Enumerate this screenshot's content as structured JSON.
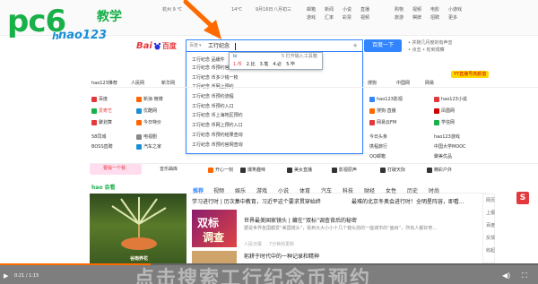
{
  "watermark": {
    "brand_pc": "pc6",
    "brand_cn": "教学",
    "brand_sub": "nao123",
    "brand_sub_lead": "h"
  },
  "topbar": {
    "weather": [
      "杭州 9 ℃",
      "14℃"
    ],
    "dates": [
      "9月16日",
      "八月初三"
    ],
    "links_row1": [
      "邮箱",
      "新闻",
      "小说",
      "直播"
    ],
    "links_row2": [
      "游戏",
      "汇率",
      "彩票",
      "视频"
    ],
    "right_row1": [
      "购物",
      "视频",
      "电影",
      "小游戏"
    ],
    "right_row2": [
      "旅游",
      "棋牌",
      "招聘",
      "更多"
    ]
  },
  "search": {
    "engine_label": "百度",
    "engine_logo": "Bai",
    "engine_logo_cn": "百度",
    "query": "工行纪念",
    "button_label": "百度一下",
    "right_hint1": "• 并随几月度的有声音",
    "right_hint2": "• 点击 • 轮到观察"
  },
  "ime": {
    "input": "bi",
    "hint": "5 打开输入工具箱",
    "candidates": [
      "币",
      "比",
      "笔",
      "必",
      "毕"
    ]
  },
  "suggestions": [
    "工行纪念 品缓件",
    "工行纪念 币预约官网",
    "工行纪念 币多少钱一枚",
    "工行纪念 币网上预约",
    "工行纪念 币预约流程",
    "工行纪念 币预约入口",
    "工行纪念 币上海地区预约",
    "工行纪念 币网上预约入口",
    "工行纪念 币预约结果查询",
    "工行纪念 币预约官网查询"
  ],
  "nav_row": [
    "hao123推荐",
    "人民网",
    "新华网"
  ],
  "nav_right": [
    "搜狗",
    "中国网",
    "网易"
  ],
  "left_sites": [
    [
      "百度",
      "新浪·微博"
    ],
    [
      "爱奇艺",
      "优酷网"
    ],
    [
      "聚划算",
      "今日特价"
    ],
    [
      "58同城",
      "电视剧"
    ],
    [
      "BOSS直聘",
      "汽车之家"
    ]
  ],
  "right_sites": [
    [
      "hao123影视",
      "hao123小说"
    ],
    [
      "搜狗·直播",
      "凤凰网"
    ],
    [
      "网易云FM",
      "学信网"
    ],
    [
      "今日头条",
      "hao123游戏"
    ],
    [
      "携程旅行",
      "中国大学MOOC"
    ],
    [
      "QQ邮箱",
      "聚美优品"
    ]
  ],
  "yy_badge": "YY直播号高颜值",
  "category_row": [
    "开心一刻",
    "爆笑趣味",
    "美女直播",
    "影视原声",
    "打破天际",
    "精彩户外"
  ],
  "left_block": {
    "banner": "曹操一个我",
    "music": "音乐曲库",
    "hao_label": "hao 会看",
    "caption": "谷雨养花"
  },
  "tabs": [
    "推荐",
    "视频",
    "娱乐",
    "游戏",
    "小说",
    "体育",
    "汽车",
    "科技",
    "财经",
    "女性",
    "历史",
    "时尚"
  ],
  "feed": {
    "tagline1": "学习进行时 | 历次集中教育，习近平这个要求贯穿始终",
    "tagline2": "最难的北京冬奥会进行时！全明星阵容，即看...",
    "headline": "世界最美国家镜头 | 藏在“双标”调查背后的秘密",
    "excerpt": "据说世界各国都爱“美国镜头”，看到大大小小十几个镜头前的一座城市的“面目”，所有人都好奇...",
    "meta": [
      "人民日报",
      "7分钟前更新"
    ],
    "thumb_line1": "双标",
    "thumb_line2": "调查",
    "second": "躬耕于时代中的一种记录和精神"
  },
  "video": {
    "time": "0:21 / 1:15",
    "subtitle": "点击搜索工行纪念币预约"
  },
  "right_rail": [
    "网页",
    "上报",
    "百度",
    "反馈",
    "收起"
  ],
  "colors": {
    "accent_blue": "#3385ff",
    "red": "#e4393c",
    "orange": "#ff6a00",
    "logo_green": "#19b04a",
    "logo_blue": "#1a8fd6"
  }
}
